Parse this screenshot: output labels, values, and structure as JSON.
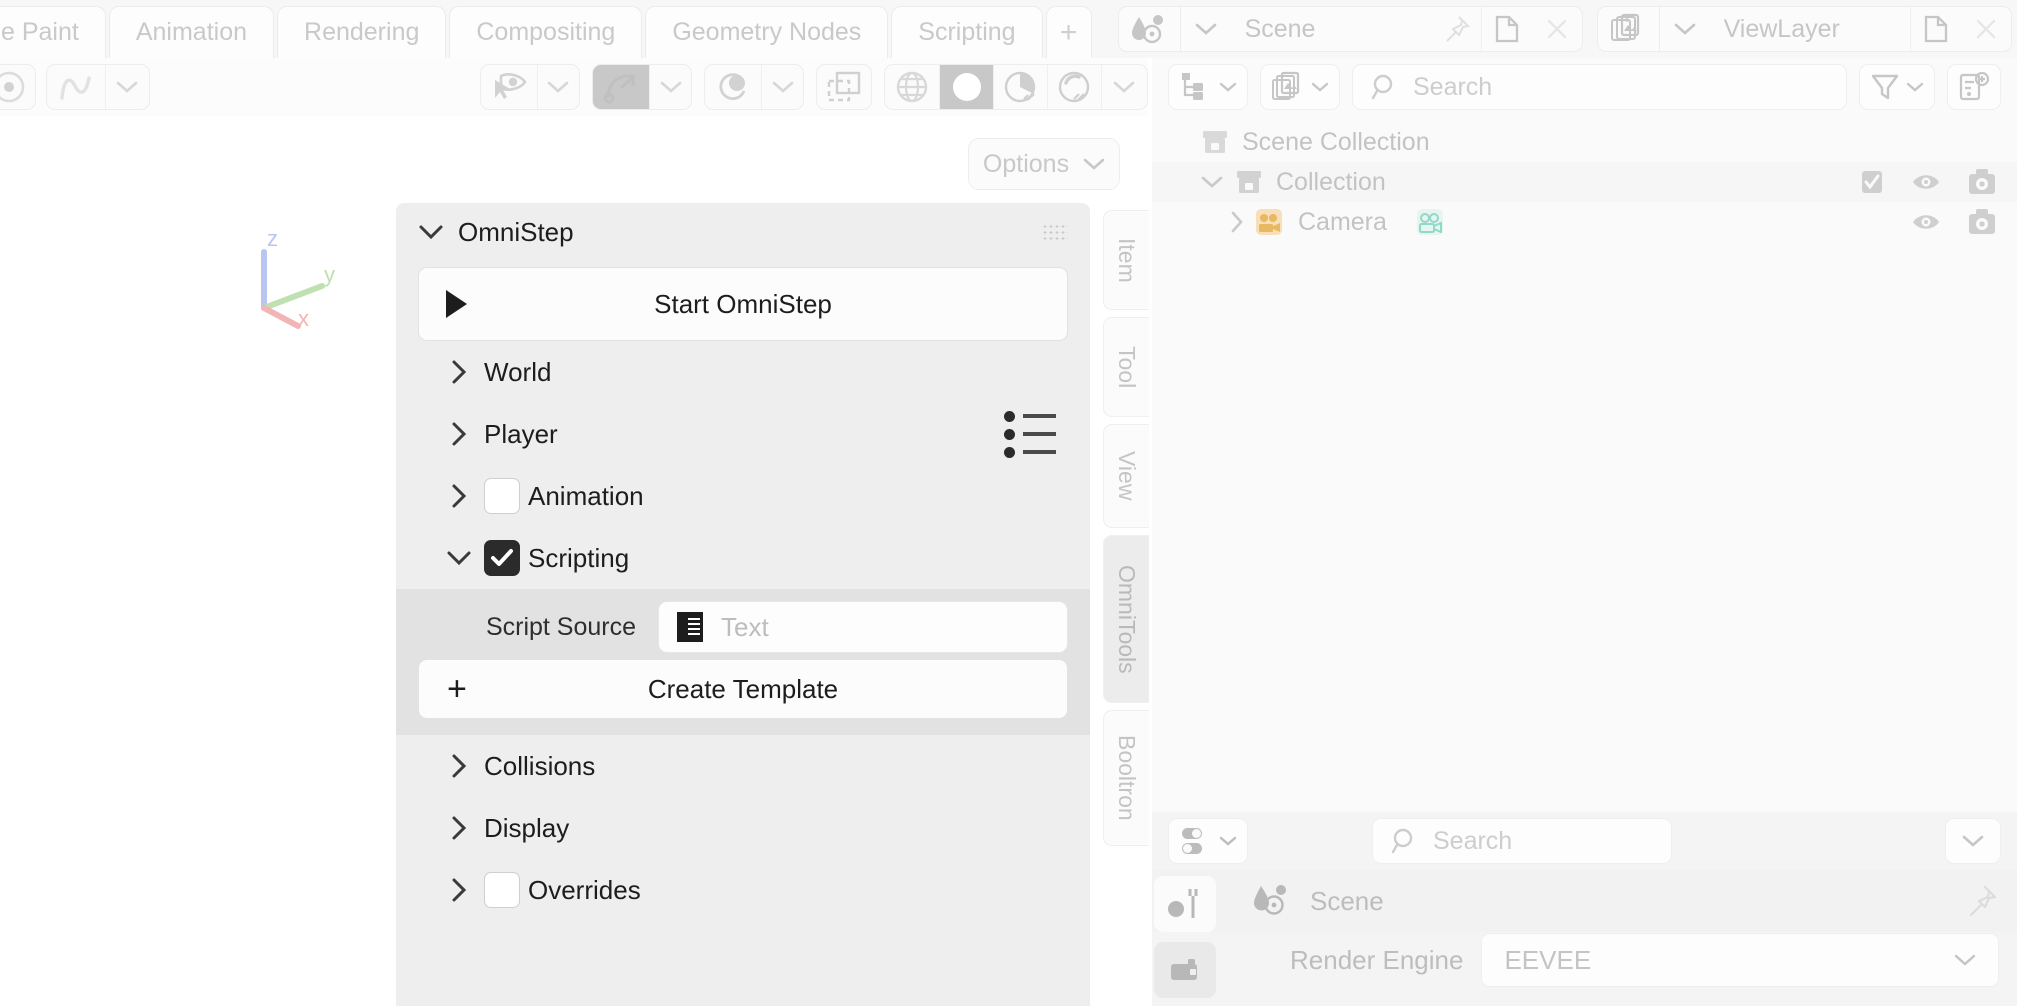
{
  "topbar": {
    "workspace_tabs": [
      {
        "label": "e Paint",
        "active": false
      },
      {
        "label": "Animation",
        "active": false
      },
      {
        "label": "Rendering",
        "active": false
      },
      {
        "label": "Compositing",
        "active": false
      },
      {
        "label": "Geometry Nodes",
        "active": false
      },
      {
        "label": "Scripting",
        "active": false
      }
    ],
    "add_workspace_label": "+",
    "scene": {
      "icon": "scene-data-icon",
      "value": "Scene",
      "pin_label": "pin-icon",
      "new_label": "new-scene-icon",
      "unlink_label": "unlink-icon"
    },
    "view_layer": {
      "icon": "view-layer-icon",
      "value": "ViewLayer",
      "new_label": "new-viewlayer-icon",
      "remove_label": "remove-viewlayer-icon"
    }
  },
  "viewport_header": {
    "buttons": [
      {
        "name": "editor-type",
        "icon": "editor-type-icon"
      },
      {
        "name": "object-mode",
        "icon": "object-mode-icon"
      },
      {
        "name": "view-selectability",
        "icon": "eye-cursor-icon"
      },
      {
        "name": "snap-toggle",
        "icon": "snap-magnet-icon",
        "active": true
      },
      {
        "name": "proportional-edit",
        "icon": "proportional-edit-icon"
      },
      {
        "name": "gizmo-toggle",
        "icon": "gizmo-icon"
      }
    ],
    "shading_modes": [
      {
        "name": "wireframe",
        "icon": "wireframe-globe-icon",
        "active": false
      },
      {
        "name": "solid",
        "icon": "solid-sphere-icon",
        "active": true
      },
      {
        "name": "material-preview",
        "icon": "material-preview-icon",
        "active": false
      },
      {
        "name": "rendered",
        "icon": "rendered-sphere-icon",
        "active": false
      }
    ],
    "options_label": "Options"
  },
  "viewport": {
    "axis_gizmo": {
      "x": "x",
      "y": "y",
      "z": "z"
    }
  },
  "sidebar_tabs": [
    {
      "label": "Item",
      "active": false
    },
    {
      "label": "Tool",
      "active": false
    },
    {
      "label": "View",
      "active": false
    },
    {
      "label": "OmniTools",
      "active": true
    },
    {
      "label": "Booltron",
      "active": false
    }
  ],
  "omnistep_panel": {
    "title": "OmniStep",
    "expanded": true,
    "start_button": {
      "label": "Start OmniStep",
      "icon": "play-icon"
    },
    "sections": [
      {
        "label": "World",
        "expanded": false,
        "has_checkbox": false
      },
      {
        "label": "Player",
        "expanded": false,
        "has_checkbox": false,
        "extra_icon": "preset-list-icon"
      },
      {
        "label": "Animation",
        "expanded": false,
        "has_checkbox": true,
        "checked": false
      },
      {
        "label": "Scripting",
        "expanded": true,
        "has_checkbox": true,
        "checked": true
      }
    ],
    "scripting": {
      "script_source_label": "Script Source",
      "script_source_value": "",
      "script_source_placeholder": "Text",
      "script_source_icon": "text-datablock-icon",
      "create_template_label": "Create Template",
      "create_template_icon": "plus-icon"
    },
    "sections_after": [
      {
        "label": "Collisions",
        "expanded": false,
        "has_checkbox": false
      },
      {
        "label": "Display",
        "expanded": false,
        "has_checkbox": false
      },
      {
        "label": "Overrides",
        "expanded": false,
        "has_checkbox": true,
        "checked": false
      }
    ]
  },
  "outliner": {
    "display_mode_icon": "outliner-display-mode-icon",
    "filter_id_icon": "filter-id-icon",
    "search_placeholder": "Search",
    "search_value": "",
    "filter_icon": "funnel-icon",
    "new_collection_icon": "new-collection-icon",
    "rows": [
      {
        "label": "Scene Collection",
        "icon": "collection-icon",
        "indent": 0,
        "expander": "none",
        "toggles": []
      },
      {
        "label": "Collection",
        "icon": "collection-icon",
        "indent": 1,
        "expander": "open",
        "toggles": [
          "checkbox-on",
          "eye-icon",
          "camera-icon"
        ]
      },
      {
        "label": "Camera",
        "icon": "camera-object-icon",
        "indent": 2,
        "expander": "closed",
        "badge": "camera-data-icon",
        "toggles": [
          "eye-icon",
          "camera-icon"
        ]
      }
    ]
  },
  "properties": {
    "editor_type_icon": "properties-editor-icon",
    "search_placeholder": "Search",
    "search_value": "",
    "options_chevron": "chevron-down-icon",
    "tabs": [
      {
        "name": "tool-tab",
        "icon": "tool-icon",
        "active": true
      },
      {
        "name": "render-tab",
        "icon": "render-camera-icon",
        "active": false
      }
    ],
    "breadcrumb": {
      "icon": "scene-data-icon",
      "label": "Scene",
      "pin_icon": "pin-icon"
    },
    "render_engine": {
      "label": "Render Engine",
      "value": "EEVEE"
    }
  },
  "colors": {
    "panel_bg": "#eeeeee",
    "subpanel_bg": "#e2e2e2",
    "text": "#1d1d1d",
    "muted_text": "#c3c3c3",
    "active_segment": "#c8c8c8",
    "checkbox_on": "#2b2b2b",
    "axis_x": "#f2b5b5",
    "axis_y": "#bfe0b0",
    "axis_z": "#b9c6ef",
    "camera_badge": "#8fd9c9"
  }
}
